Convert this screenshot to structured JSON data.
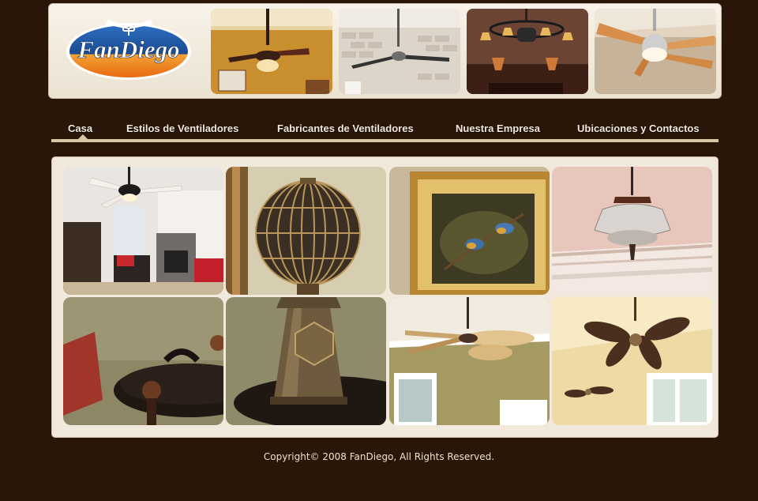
{
  "brand": {
    "name": "FanDiego"
  },
  "nav": {
    "items": [
      {
        "label": "Casa",
        "active": true
      },
      {
        "label": "Estilos de Ventiladores"
      },
      {
        "label": "Fabricantes de Ventiladores"
      },
      {
        "label": "Nuestra Empresa"
      },
      {
        "label": "Ubicaciones y Contactos"
      }
    ]
  },
  "header_photos": [
    {
      "subject": "ceiling fan with light kit over mustard wall"
    },
    {
      "subject": "industrial ceiling fan over white brick"
    },
    {
      "subject": "wrought iron chandelier fan with lamps"
    },
    {
      "subject": "modern wood blade fan with globe light"
    }
  ],
  "gallery": [
    {
      "subject": "living room with ceiling fan and fireplace"
    },
    {
      "subject": "vintage globe cage fan top"
    },
    {
      "subject": "framed bird painting in gold frame"
    },
    {
      "subject": "ornate light fixture on decorative ceiling"
    },
    {
      "subject": "dark tray and red cushion"
    },
    {
      "subject": "vintage desk fan bronze base"
    },
    {
      "subject": "palm leaf ceiling fan over window"
    },
    {
      "subject": "wicker leaf ceiling fans on porch"
    }
  ],
  "footer": {
    "copyright": "Copyright© 2008 FanDiego, All Rights Reserved."
  },
  "colors": {
    "background": "#2a1509",
    "panel": "#f1e9dc",
    "nav_bar": "#d6c7a6",
    "nav_text": "#f3e9d8",
    "logo_blue": "#1f4d95",
    "logo_orange": "#f08a1d"
  }
}
